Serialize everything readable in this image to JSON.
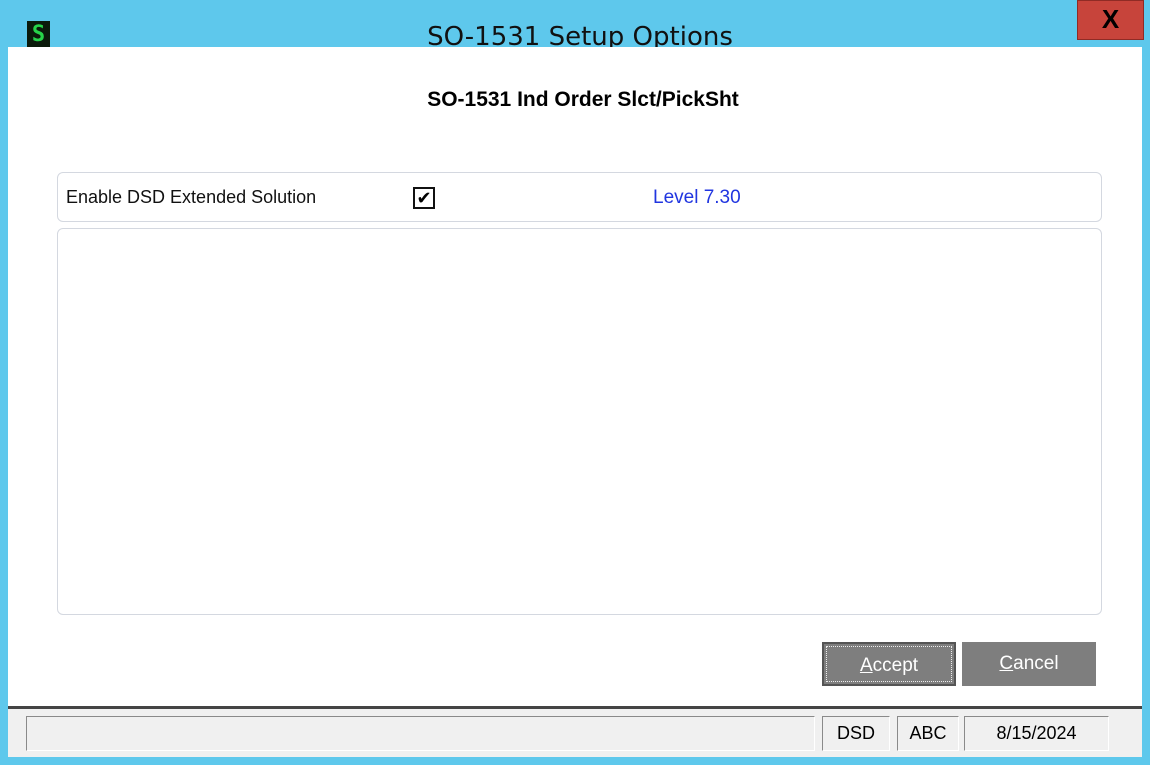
{
  "window": {
    "title": "SO-1531 Setup Options",
    "app_icon_letter": "S",
    "close_label": "X"
  },
  "form": {
    "heading": "SO-1531 Ind Order Slct/PickSht",
    "enable_label": "Enable DSD Extended Solution",
    "enable_checked": true,
    "checkbox_mark": "✔",
    "level_text": "Level  7.30"
  },
  "buttons": {
    "accept_label": "Accept",
    "accept_hotkey": "A",
    "accept_rest": "ccept",
    "cancel_hotkey": "C",
    "cancel_rest": "ancel"
  },
  "statusbar": {
    "message": "",
    "company": "DSD",
    "user": "ABC",
    "date": "8/15/2024"
  },
  "colors": {
    "frame": "#5ec8ec",
    "close_button": "#c7443b",
    "button_face": "#7e7e7e",
    "level_text": "#2035e0"
  }
}
